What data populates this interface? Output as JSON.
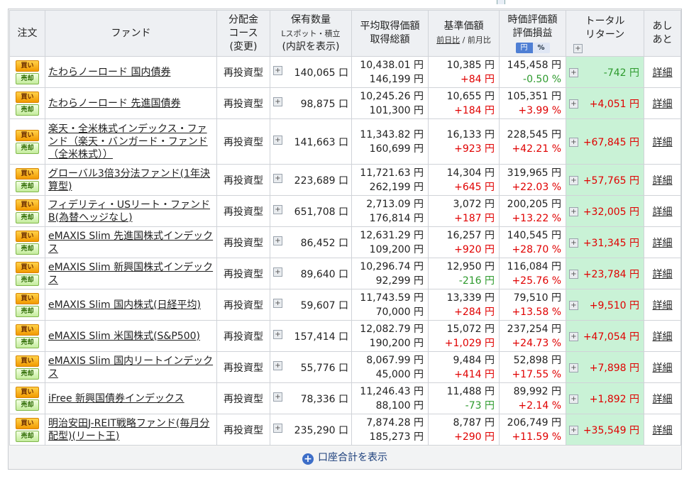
{
  "header": {
    "order": "注文",
    "fund": "ファンド",
    "course": [
      "分配金",
      "コース",
      "(変更)"
    ],
    "qty": [
      "保有数量",
      "Lスポット・積立",
      "(内訳を表示)"
    ],
    "avg": [
      "平均取得価額",
      "取得総額"
    ],
    "base": [
      "基準価額",
      "前日比",
      "前月比"
    ],
    "valuation": [
      "時価評価額",
      "評価損益"
    ],
    "toggle": [
      "円",
      "%"
    ],
    "total": [
      "トータル",
      "リターン"
    ],
    "ashiato": [
      "あし",
      "あと"
    ]
  },
  "icons": {
    "plus": "plus-box-icon",
    "footer": "plus-circle-icon"
  },
  "colors": {
    "gain": "#e00000",
    "loss": "#2d9a2d",
    "total_bg": "#c9f2d6"
  },
  "labels": {
    "buy": "買い",
    "sell": "売却",
    "detail": "詳細",
    "slash": " / "
  },
  "rows": [
    {
      "fund": "たわらノーロード 国内債券",
      "course": "再投資型",
      "qty": "140,065 口",
      "avg": "10,438.01 円",
      "cost": "146,199 円",
      "base": "10,385 円",
      "base_change": "+84 円",
      "valuation": "145,458 円",
      "gain": "-0.50 %",
      "total": "-742 円",
      "gain_dir": "green",
      "total_dir": "green",
      "bc_dir": "red"
    },
    {
      "fund": "たわらノーロード 先進国債券",
      "course": "再投資型",
      "qty": "98,875 口",
      "avg": "10,245.26 円",
      "cost": "101,300 円",
      "base": "10,655 円",
      "base_change": "+184 円",
      "valuation": "105,351 円",
      "gain": "+3.99 %",
      "total": "+4,051 円",
      "gain_dir": "red",
      "total_dir": "red",
      "bc_dir": "red"
    },
    {
      "fund": "楽天・全米株式インデックス・ファンド（楽天・バンガード・ファンド（全米株式））",
      "course": "再投資型",
      "qty": "141,663 口",
      "avg": "11,343.82 円",
      "cost": "160,699 円",
      "base": "16,133 円",
      "base_change": "+923 円",
      "valuation": "228,545 円",
      "gain": "+42.21 %",
      "total": "+67,845 円",
      "gain_dir": "red",
      "total_dir": "red",
      "bc_dir": "red",
      "tall": true
    },
    {
      "fund": "グローバル3倍3分法ファンド(1年決算型)",
      "course": "再投資型",
      "qty": "223,689 口",
      "avg": "11,721.63 円",
      "cost": "262,199 円",
      "base": "14,304 円",
      "base_change": "+645 円",
      "valuation": "319,965 円",
      "gain": "+22.03 %",
      "total": "+57,765 円",
      "gain_dir": "red",
      "total_dir": "red",
      "bc_dir": "red"
    },
    {
      "fund": "フィデリティ・USリート・ファンドB(為替ヘッジなし)",
      "course": "再投資型",
      "qty": "651,708 口",
      "avg": "2,713.09 円",
      "cost": "176,814 円",
      "base": "3,072 円",
      "base_change": "+187 円",
      "valuation": "200,205 円",
      "gain": "+13.22 %",
      "total": "+32,005 円",
      "gain_dir": "red",
      "total_dir": "red",
      "bc_dir": "red"
    },
    {
      "fund": "eMAXIS Slim 先進国株式インデックス",
      "course": "再投資型",
      "qty": "86,452 口",
      "avg": "12,631.29 円",
      "cost": "109,200 円",
      "base": "16,257 円",
      "base_change": "+920 円",
      "valuation": "140,545 円",
      "gain": "+28.70 %",
      "total": "+31,345 円",
      "gain_dir": "red",
      "total_dir": "red",
      "bc_dir": "red"
    },
    {
      "fund": "eMAXIS Slim 新興国株式インデックス",
      "course": "再投資型",
      "qty": "89,640 口",
      "avg": "10,296.74 円",
      "cost": "92,299 円",
      "base": "12,950 円",
      "base_change": "-216 円",
      "valuation": "116,084 円",
      "gain": "+25.76 %",
      "total": "+23,784 円",
      "gain_dir": "red",
      "total_dir": "red",
      "bc_dir": "green"
    },
    {
      "fund": "eMAXIS Slim 国内株式(日経平均)",
      "course": "再投資型",
      "qty": "59,607 口",
      "avg": "11,743.59 円",
      "cost": "70,000 円",
      "base": "13,339 円",
      "base_change": "+284 円",
      "valuation": "79,510 円",
      "gain": "+13.58 %",
      "total": "+9,510 円",
      "gain_dir": "red",
      "total_dir": "red",
      "bc_dir": "red"
    },
    {
      "fund": "eMAXIS Slim 米国株式(S&P500)",
      "course": "再投資型",
      "qty": "157,414 口",
      "avg": "12,082.79 円",
      "cost": "190,200 円",
      "base": "15,072 円",
      "base_change": "+1,029 円",
      "valuation": "237,254 円",
      "gain": "+24.73 %",
      "total": "+47,054 円",
      "gain_dir": "red",
      "total_dir": "red",
      "bc_dir": "red"
    },
    {
      "fund": "eMAXIS Slim 国内リートインデックス",
      "course": "再投資型",
      "qty": "55,776 口",
      "avg": "8,067.99 円",
      "cost": "45,000 円",
      "base": "9,484 円",
      "base_change": "+414 円",
      "valuation": "52,898 円",
      "gain": "+17.55 %",
      "total": "+7,898 円",
      "gain_dir": "red",
      "total_dir": "red",
      "bc_dir": "red"
    },
    {
      "fund": "iFree 新興国債券インデックス",
      "course": "再投資型",
      "qty": "78,336 口",
      "avg": "11,246.43 円",
      "cost": "88,100 円",
      "base": "11,488 円",
      "base_change": "-73 円",
      "valuation": "89,992 円",
      "gain": "+2.14 %",
      "total": "+1,892 円",
      "gain_dir": "red",
      "total_dir": "red",
      "bc_dir": "green"
    },
    {
      "fund": "明治安田J-REIT戦略ファンド(毎月分配型)(リート王)",
      "course": "再投資型",
      "qty": "235,290 口",
      "avg": "7,874.28 円",
      "cost": "185,273 円",
      "base": "8,787 円",
      "base_change": "+290 円",
      "valuation": "206,749 円",
      "gain": "+11.59 %",
      "total": "+35,549 円",
      "gain_dir": "red",
      "total_dir": "red",
      "bc_dir": "red"
    }
  ],
  "footer": {
    "label": "口座合計を表示"
  }
}
